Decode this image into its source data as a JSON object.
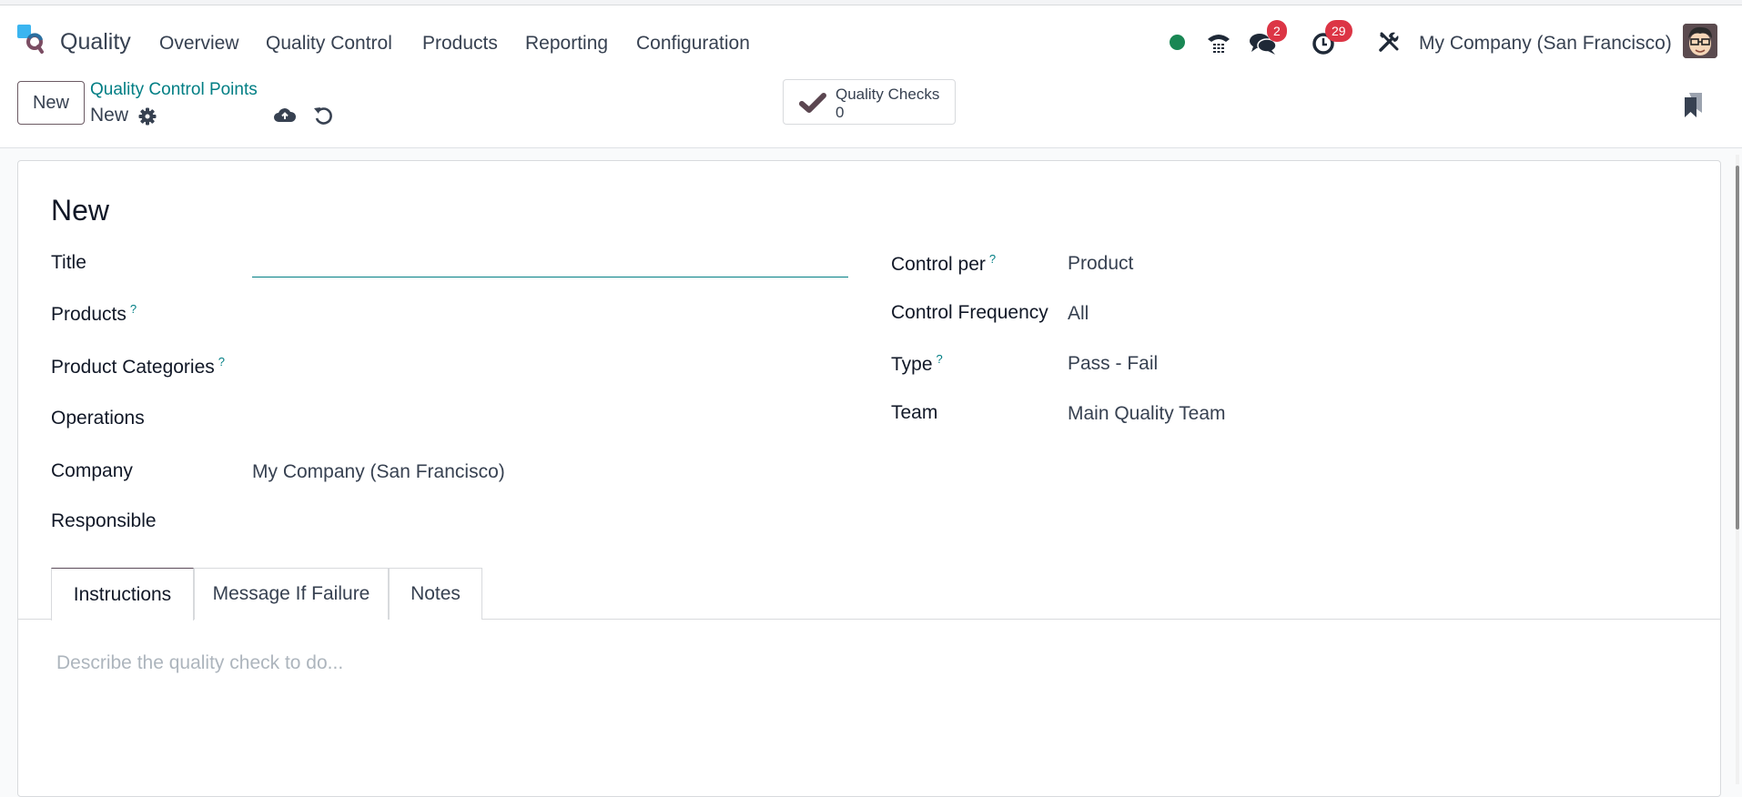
{
  "navbar": {
    "app_name": "Quality",
    "menu": [
      "Overview",
      "Quality Control",
      "Products",
      "Reporting",
      "Configuration"
    ],
    "status_color": "#198754",
    "messages_badge": "2",
    "activities_badge": "29",
    "company": "My Company (San Francisco)"
  },
  "control_panel": {
    "new_button": "New",
    "breadcrumb_parent": "Quality Control Points",
    "breadcrumb_current": "New",
    "smart_button": {
      "label": "Quality Checks",
      "value": "0"
    }
  },
  "form": {
    "record_title": "New",
    "left_fields": [
      {
        "label": "Title",
        "value": "",
        "tooltip": false
      },
      {
        "label": "Products",
        "value": "",
        "tooltip": true
      },
      {
        "label": "Product Categories",
        "value": "",
        "tooltip": true
      },
      {
        "label": "Operations",
        "value": "",
        "tooltip": false
      },
      {
        "label": "Company",
        "value": "My Company (San Francisco)",
        "tooltip": false
      },
      {
        "label": "Responsible",
        "value": "",
        "tooltip": false
      }
    ],
    "right_fields": [
      {
        "label": "Control per",
        "value": "Product",
        "tooltip": true
      },
      {
        "label": "Control Frequency",
        "value": "All",
        "tooltip": false
      },
      {
        "label": "Type",
        "value": "Pass - Fail",
        "tooltip": true
      },
      {
        "label": "Team",
        "value": "Main Quality Team",
        "tooltip": false
      }
    ],
    "tooltip_mark": "?",
    "tabs": [
      "Instructions",
      "Message If Failure",
      "Notes"
    ],
    "active_tab": "Instructions",
    "instructions_placeholder": "Describe the quality check to do..."
  },
  "colors": {
    "accent": "#017e84",
    "badge": "#dc3545",
    "brand": "#714b67"
  }
}
